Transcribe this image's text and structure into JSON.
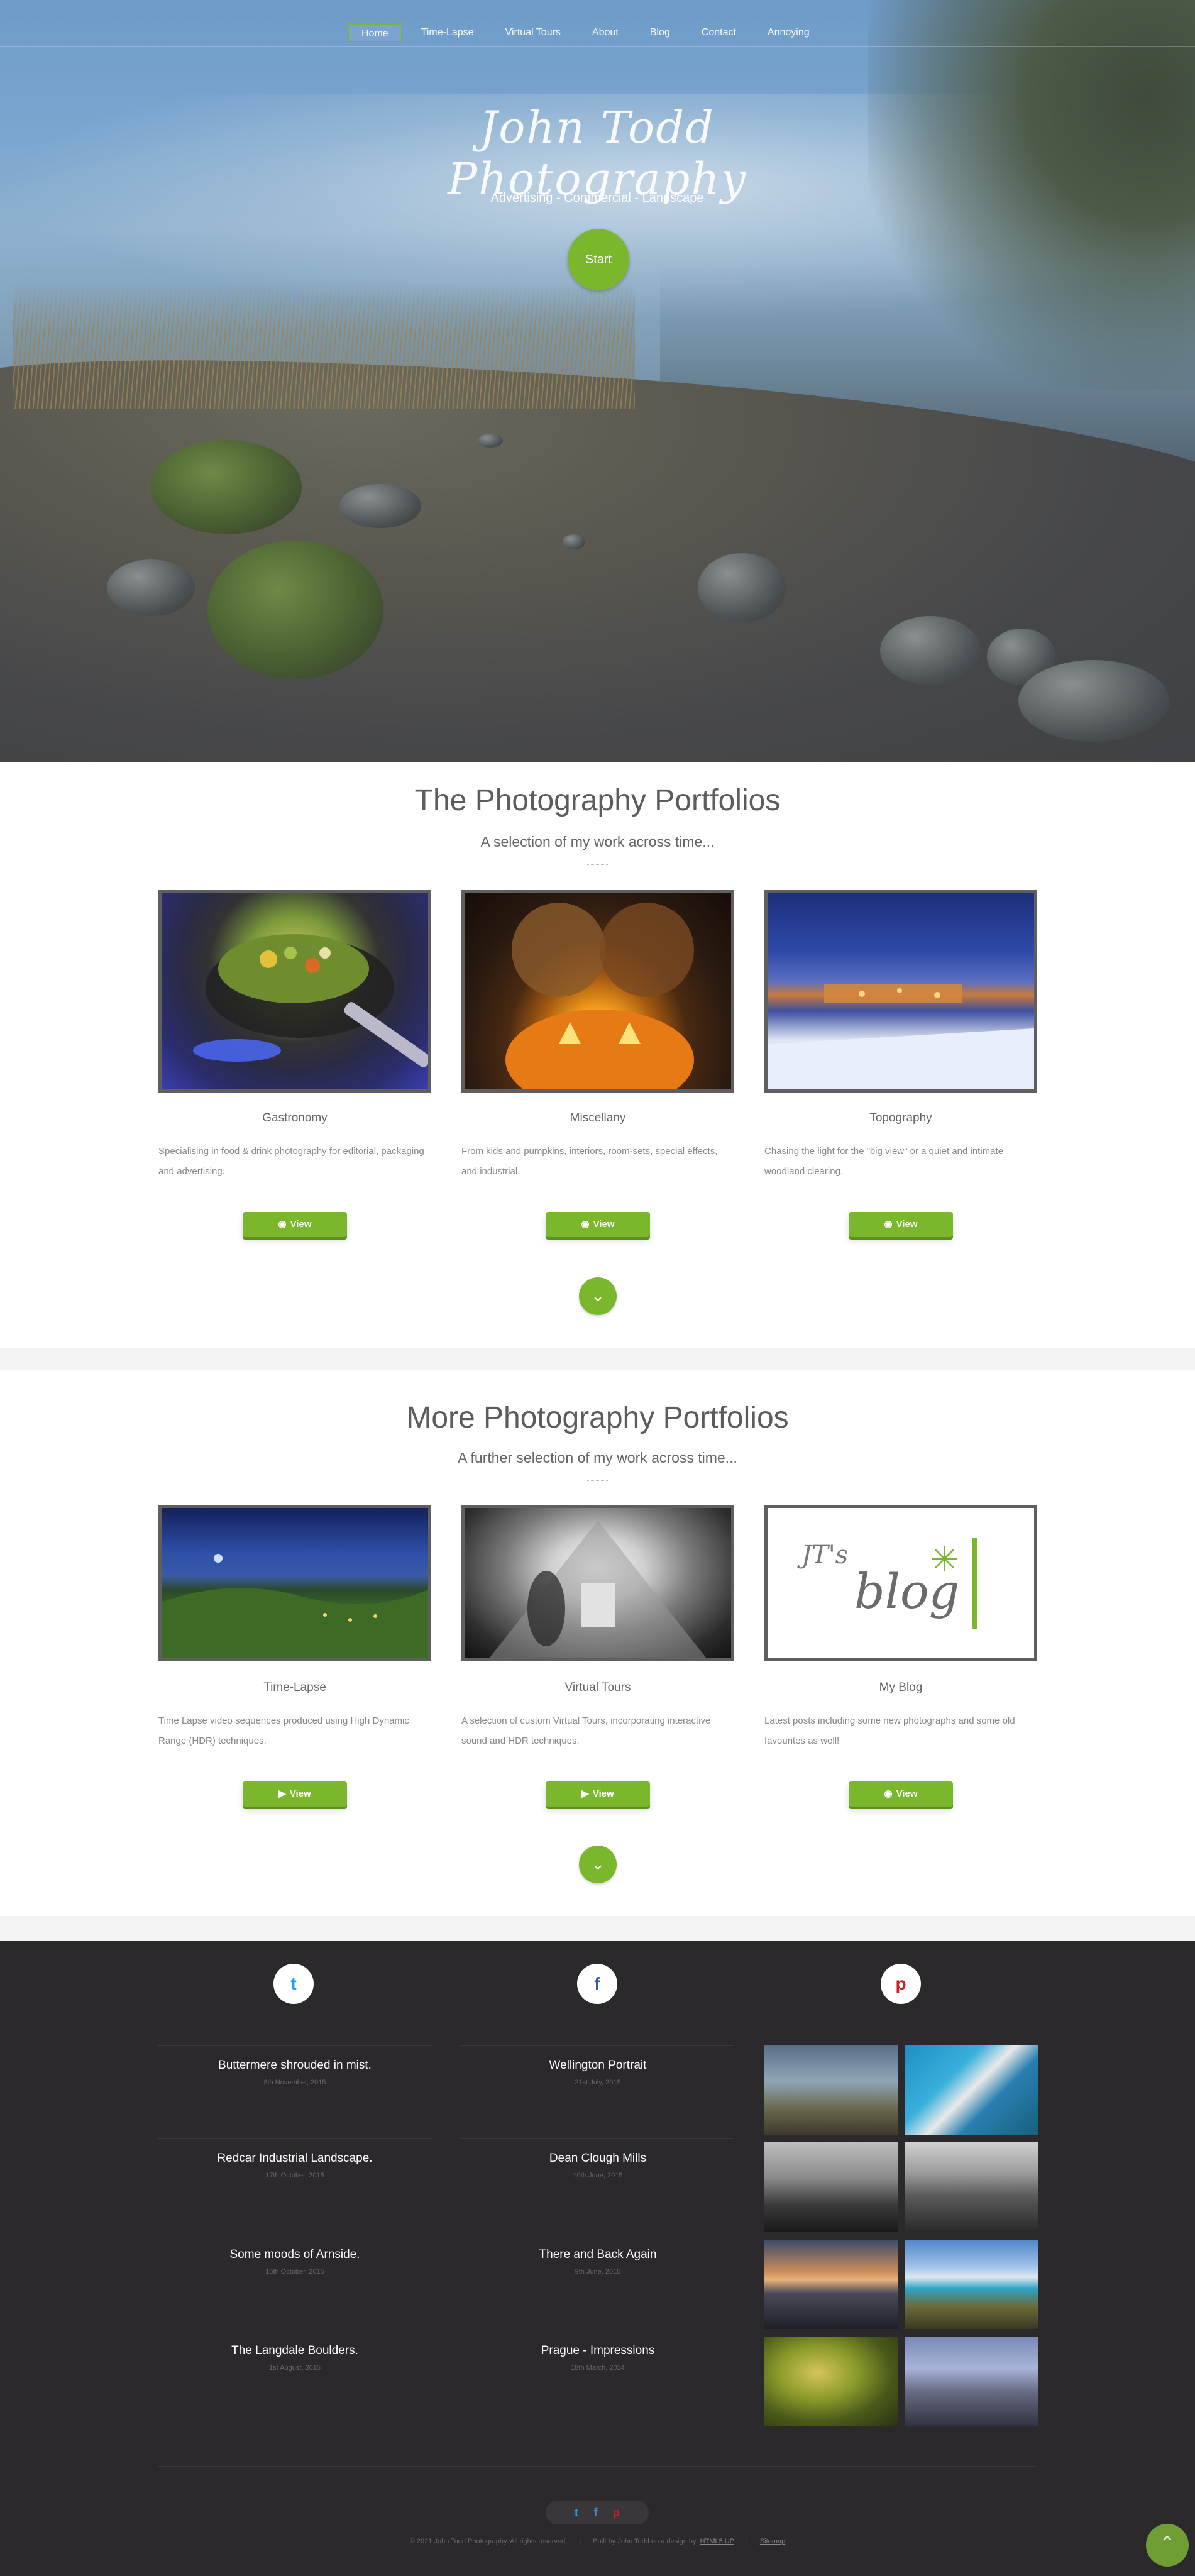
{
  "nav": {
    "items": [
      {
        "label": "Home",
        "active": true
      },
      {
        "label": "Time-Lapse"
      },
      {
        "label": "Virtual Tours"
      },
      {
        "label": "About"
      },
      {
        "label": "Blog"
      },
      {
        "label": "Contact"
      },
      {
        "label": "Annoying"
      }
    ]
  },
  "hero": {
    "title": "John Todd Photography",
    "subtitle": "Advertising - Commercial - Landscape",
    "start_label": "Start"
  },
  "section1": {
    "title": "The Photography Portfolios",
    "subtitle": "A selection of my work across time...",
    "cards": [
      {
        "name": "Gastronomy",
        "desc": "Specialising in food & drink photography for editorial, packaging and advertising.",
        "button": "View",
        "icon": "camera-icon"
      },
      {
        "name": "Miscellany",
        "desc": "From kids and pumpkins, interiors, room-sets, special effects, and industrial.",
        "button": "View",
        "icon": "camera-icon"
      },
      {
        "name": "Topography",
        "desc": "Chasing the light for the \"big view\" or a quiet and intimate woodland clearing.",
        "button": "View",
        "icon": "camera-icon"
      }
    ]
  },
  "section2": {
    "title": "More Photography Portfolios",
    "subtitle": "A further selection of my work across time...",
    "cards": [
      {
        "name": "Time-Lapse",
        "desc": "Time Lapse video sequences produced using High Dynamic Range (HDR) techniques.",
        "button": "View",
        "icon": "video-icon"
      },
      {
        "name": "Virtual Tours",
        "desc": "A selection of custom Virtual Tours, incorporating interactive sound and HDR techniques.",
        "button": "View",
        "icon": "video-icon"
      },
      {
        "name": "My Blog",
        "desc": "Latest posts including some new photographs and some old favourites as well!",
        "button": "View",
        "icon": "camera-icon"
      }
    ],
    "blog_logo": {
      "script": "JT's",
      "word": "blog"
    }
  },
  "footer": {
    "social": [
      {
        "name": "twitter",
        "glyph": "t",
        "color": "#1da1f2"
      },
      {
        "name": "facebook",
        "glyph": "f",
        "color": "#3b5998"
      },
      {
        "name": "pinterest",
        "glyph": "p",
        "color": "#cb2027"
      }
    ],
    "posts_left": [
      {
        "title": "Buttermere shrouded in mist.",
        "date": "8th November, 2015"
      },
      {
        "title": "Redcar Industrial Landscape.",
        "date": "17th October, 2015"
      },
      {
        "title": "Some moods of Arnside.",
        "date": "15th October, 2015"
      },
      {
        "title": "The Langdale Boulders.",
        "date": "1st August, 2015"
      }
    ],
    "posts_right": [
      {
        "title": "Wellington Portrait",
        "date": "21st July, 2015"
      },
      {
        "title": "Dean Clough Mills",
        "date": "10th June, 2015"
      },
      {
        "title": "There and Back Again",
        "date": "9th June, 2015"
      },
      {
        "title": "Prague - Impressions",
        "date": "18th March, 2014"
      }
    ],
    "copyright": "© 2021 John Todd Photography. All rights reserved.",
    "built_by": "Built by John Todd on a design by:",
    "built_link": "HTML5 UP",
    "sitemap": "Sitemap",
    "back_to_top_icon": "chevron-up-icon"
  },
  "colors": {
    "accent": "#7bb72d",
    "footer_bg": "#2c292d"
  }
}
